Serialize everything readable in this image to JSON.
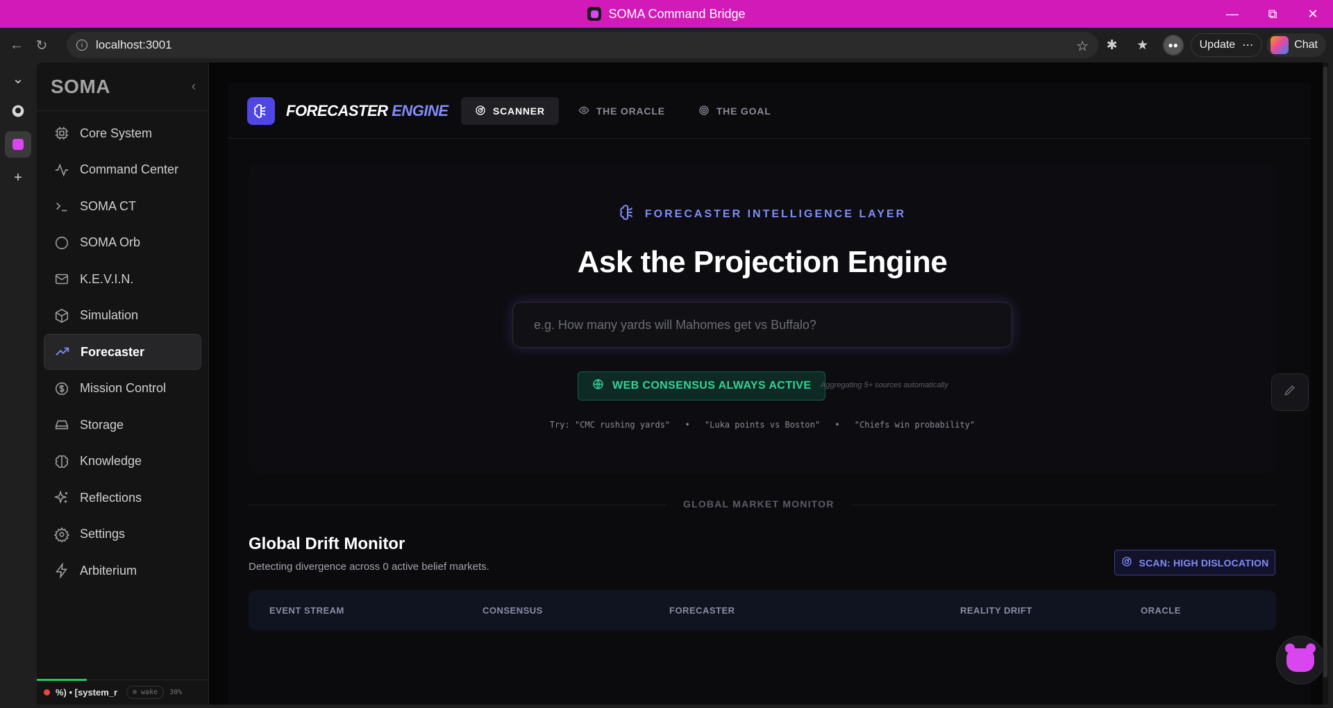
{
  "window": {
    "title": "SOMA Command Bridge"
  },
  "browser": {
    "url": "localhost:3001",
    "update_label": "Update",
    "chat_label": "Chat"
  },
  "sidebar": {
    "brand": "SOMA",
    "items": [
      {
        "label": "Core System",
        "icon": "cpu-icon"
      },
      {
        "label": "Command Center",
        "icon": "activity-icon"
      },
      {
        "label": "SOMA CT",
        "icon": "terminal-icon"
      },
      {
        "label": "SOMA Orb",
        "icon": "circle-icon"
      },
      {
        "label": "K.E.V.I.N.",
        "icon": "mail-icon"
      },
      {
        "label": "Simulation",
        "icon": "box-icon"
      },
      {
        "label": "Forecaster",
        "icon": "trending-up-icon"
      },
      {
        "label": "Mission Control",
        "icon": "dollar-circle-icon"
      },
      {
        "label": "Storage",
        "icon": "hard-drive-icon"
      },
      {
        "label": "Knowledge",
        "icon": "brain-icon"
      },
      {
        "label": "Reflections",
        "icon": "sparkles-icon"
      },
      {
        "label": "Settings",
        "icon": "gear-icon"
      },
      {
        "label": "Arbiterium",
        "icon": "bolt-icon"
      }
    ],
    "active_item": "Forecaster",
    "footer": {
      "status_text": "%) • [system_r",
      "wake_label": "⊚ wake",
      "percent": "30%"
    }
  },
  "forecaster": {
    "title_main": "FORECASTER",
    "title_accent": "ENGINE",
    "tabs": [
      {
        "label": "SCANNER",
        "active": true
      },
      {
        "label": "THE ORACLE",
        "active": false
      },
      {
        "label": "THE GOAL",
        "active": false
      }
    ],
    "hero": {
      "kicker": "FORECASTER INTELLIGENCE LAYER",
      "heading": "Ask the Projection Engine",
      "query_placeholder": "e.g. How many yards will Mahomes get vs Buffalo?",
      "consensus_label": "WEB CONSENSUS ALWAYS ACTIVE",
      "aggregating_note": "Aggregating 5+ sources automatically",
      "try_label": "Try:",
      "examples": [
        "\"CMC rushing yards\"",
        "\"Luka points vs Boston\"",
        "\"Chiefs win probability\""
      ]
    },
    "divider_label": "GLOBAL MARKET MONITOR",
    "drift": {
      "title": "Global Drift Monitor",
      "subtitle": "Detecting divergence across 0 active belief markets.",
      "scan_button": "SCAN: HIGH DISLOCATION",
      "columns": [
        "EVENT STREAM",
        "CONSENSUS",
        "FORECASTER",
        "REALITY DRIFT",
        "ORACLE"
      ]
    }
  },
  "colors": {
    "titlebar": "#d21ab8",
    "accent": "#818cf8",
    "logo_bg": "#4f46e5",
    "consensus_green": "#34d399",
    "brand_pink": "#d946ef"
  }
}
